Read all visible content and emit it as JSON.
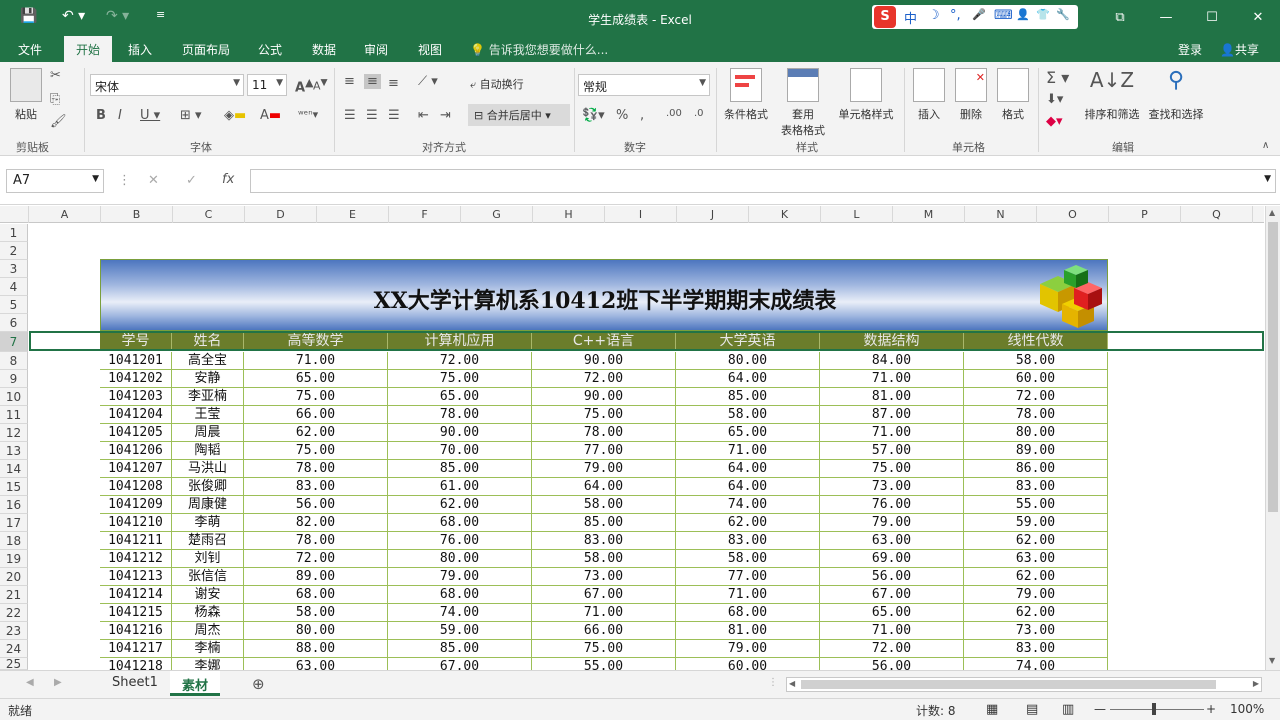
{
  "titlebar": {
    "title": "学生成绩表 - Excel",
    "ime_labels": [
      "中",
      "☽",
      "°,",
      "🎤",
      "⌨",
      "👤",
      "👕",
      "🔧"
    ],
    "min": "—",
    "max": "☐",
    "close": "✕",
    "restore": "⧉"
  },
  "tabs": [
    "文件",
    "开始",
    "插入",
    "页面布局",
    "公式",
    "数据",
    "审阅",
    "视图"
  ],
  "active_tab": "开始",
  "tell_me": "告诉我您想要做什么...",
  "login": "登录",
  "share": "共享",
  "ribbon": {
    "clipboard": {
      "paste": "粘贴",
      "label": "剪贴板"
    },
    "font": {
      "name": "宋体",
      "size": "11",
      "label": "字体"
    },
    "align": {
      "wrap": "自动换行",
      "merge": "合并后居中",
      "label": "对齐方式"
    },
    "number": {
      "format": "常规",
      "label": "数字"
    },
    "styles": {
      "cond": "条件格式",
      "table1": "套用",
      "table2": "表格格式",
      "cell": "单元格样式",
      "label": "样式"
    },
    "cells": {
      "insert": "插入",
      "delete": "删除",
      "format": "格式",
      "label": "单元格"
    },
    "edit": {
      "sort": "排序和筛选",
      "find": "查找和选择",
      "label": "编辑"
    }
  },
  "namebox": "A7",
  "fx": "fx",
  "columns": [
    "A",
    "B",
    "C",
    "D",
    "E",
    "F",
    "G",
    "H",
    "I",
    "J",
    "K",
    "L",
    "M",
    "N",
    "O",
    "P",
    "Q"
  ],
  "rows": [
    "1",
    "2",
    "3",
    "4",
    "5",
    "6",
    "7",
    "8",
    "9",
    "10",
    "11",
    "12",
    "13",
    "14",
    "15",
    "16",
    "17",
    "18",
    "19",
    "20",
    "21",
    "22",
    "23",
    "24",
    "25"
  ],
  "table_title": "XX大学计算机系10412班下半学期期末成绩表",
  "headers": [
    "学号",
    "姓名",
    "高等数学",
    "计算机应用",
    "C++语言",
    "大学英语",
    "数据结构",
    "线性代数"
  ],
  "data": [
    [
      "1041201",
      "高全宝",
      "71.00",
      "72.00",
      "90.00",
      "80.00",
      "84.00",
      "58.00"
    ],
    [
      "1041202",
      "安静",
      "65.00",
      "75.00",
      "72.00",
      "64.00",
      "71.00",
      "60.00"
    ],
    [
      "1041203",
      "李亚楠",
      "75.00",
      "65.00",
      "90.00",
      "85.00",
      "81.00",
      "72.00"
    ],
    [
      "1041204",
      "王莹",
      "66.00",
      "78.00",
      "75.00",
      "58.00",
      "87.00",
      "78.00"
    ],
    [
      "1041205",
      "周晨",
      "62.00",
      "90.00",
      "78.00",
      "65.00",
      "71.00",
      "80.00"
    ],
    [
      "1041206",
      "陶韬",
      "75.00",
      "70.00",
      "77.00",
      "71.00",
      "57.00",
      "89.00"
    ],
    [
      "1041207",
      "马洪山",
      "78.00",
      "85.00",
      "79.00",
      "64.00",
      "75.00",
      "86.00"
    ],
    [
      "1041208",
      "张俊卿",
      "83.00",
      "61.00",
      "64.00",
      "64.00",
      "73.00",
      "83.00"
    ],
    [
      "1041209",
      "周康健",
      "56.00",
      "62.00",
      "58.00",
      "74.00",
      "76.00",
      "55.00"
    ],
    [
      "1041210",
      "李萌",
      "82.00",
      "68.00",
      "85.00",
      "62.00",
      "79.00",
      "59.00"
    ],
    [
      "1041211",
      "楚雨召",
      "78.00",
      "76.00",
      "83.00",
      "83.00",
      "63.00",
      "62.00"
    ],
    [
      "1041212",
      "刘钊",
      "72.00",
      "80.00",
      "58.00",
      "58.00",
      "69.00",
      "63.00"
    ],
    [
      "1041213",
      "张信信",
      "89.00",
      "79.00",
      "73.00",
      "77.00",
      "56.00",
      "62.00"
    ],
    [
      "1041214",
      "谢安",
      "68.00",
      "68.00",
      "67.00",
      "71.00",
      "67.00",
      "79.00"
    ],
    [
      "1041215",
      "杨森",
      "58.00",
      "74.00",
      "71.00",
      "68.00",
      "65.00",
      "62.00"
    ],
    [
      "1041216",
      "周杰",
      "80.00",
      "59.00",
      "66.00",
      "81.00",
      "71.00",
      "73.00"
    ],
    [
      "1041217",
      "李楠",
      "88.00",
      "85.00",
      "75.00",
      "79.00",
      "72.00",
      "83.00"
    ],
    [
      "1041218",
      "李娜",
      "63.00",
      "67.00",
      "55.00",
      "60.00",
      "56.00",
      "74.00"
    ]
  ],
  "sheets": [
    "Sheet1",
    "素材"
  ],
  "active_sheet": "素材",
  "status": {
    "ready": "就绪",
    "count": "计数: 8",
    "zoom": "100%"
  }
}
